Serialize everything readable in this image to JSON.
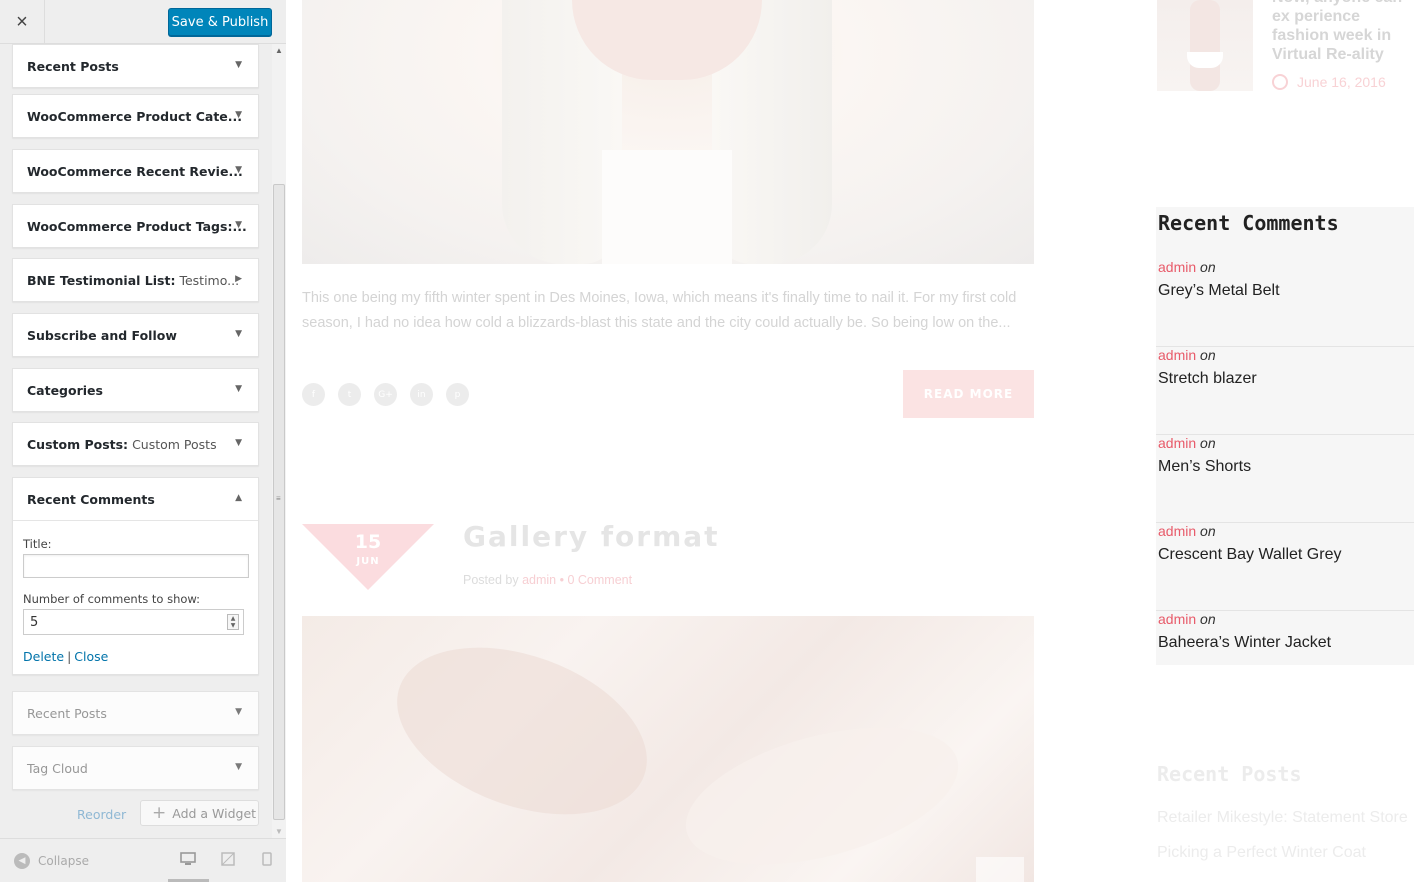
{
  "customizer": {
    "close_icon": "×",
    "save_label": "Save & Publish",
    "widgets": [
      {
        "title": "Recent Posts",
        "extra": ""
      },
      {
        "title": "WooCommerce Product Cate...",
        "extra": ""
      },
      {
        "title": "WooCommerce Recent Revie...",
        "extra": ""
      },
      {
        "title": "WooCommerce Product Tags:...",
        "extra": ""
      },
      {
        "title": "BNE Testimonial List:",
        "extra": "Testimo..."
      },
      {
        "title": "Subscribe and Follow",
        "extra": ""
      },
      {
        "title": "Categories",
        "extra": ""
      },
      {
        "title": "Custom Posts:",
        "extra": "Custom Posts"
      },
      {
        "title": "Recent Comments",
        "extra": ""
      },
      {
        "title": "Recent Posts",
        "extra": ""
      },
      {
        "title": "Tag Cloud",
        "extra": ""
      }
    ],
    "open_widget": {
      "title_label": "Title:",
      "title_value": "",
      "number_label": "Number of comments to show:",
      "number_value": "5",
      "delete_label": "Delete",
      "separator": "|",
      "close_label": "Close"
    },
    "reorder_label": "Reorder",
    "add_widget_label": "Add a Widget",
    "collapse_label": "Collapse",
    "accent_color": "#0085ba"
  },
  "preview": {
    "excerpt": "This one being my fifth winter spent in Des Moines, Iowa, which means it's finally time to nail it. For my first cold season, I had no idea how cold a blizzards-blast this state and the city could actually be.  So being low on the...",
    "share_icons": [
      "f",
      "t",
      "G+",
      "in",
      "p"
    ],
    "read_more_label": "READ MORE",
    "date_day": "15",
    "date_month": "JUN",
    "post_title": "Gallery format",
    "meta_prefix": "Posted by",
    "meta_author": "admin",
    "meta_bullet": "•",
    "meta_comments": "0 Comment",
    "sidebar_post_title": "Now, anyone can ex perience fashion week in Virtual Re-ality",
    "sidebar_post_date": "June 16, 2016",
    "recent_comments_heading": "Recent Comments",
    "recent_comments": [
      {
        "author": "admin",
        "on": "on",
        "link": "Grey’s Metal Belt"
      },
      {
        "author": "admin",
        "on": "on",
        "link": "Stretch blazer"
      },
      {
        "author": "admin",
        "on": "on",
        "link": "Men’s Shorts"
      },
      {
        "author": "admin",
        "on": "on",
        "link": "Crescent Bay Wallet Grey"
      },
      {
        "author": "admin",
        "on": "on",
        "link": "Baheera’s Winter Jacket"
      }
    ],
    "recent_posts_heading": "Recent Posts",
    "recent_posts": [
      "Retailer Mikestyle: Statement Store",
      "Picking a Perfect Winter Coat"
    ],
    "accent_pink": "#e85b6a"
  }
}
